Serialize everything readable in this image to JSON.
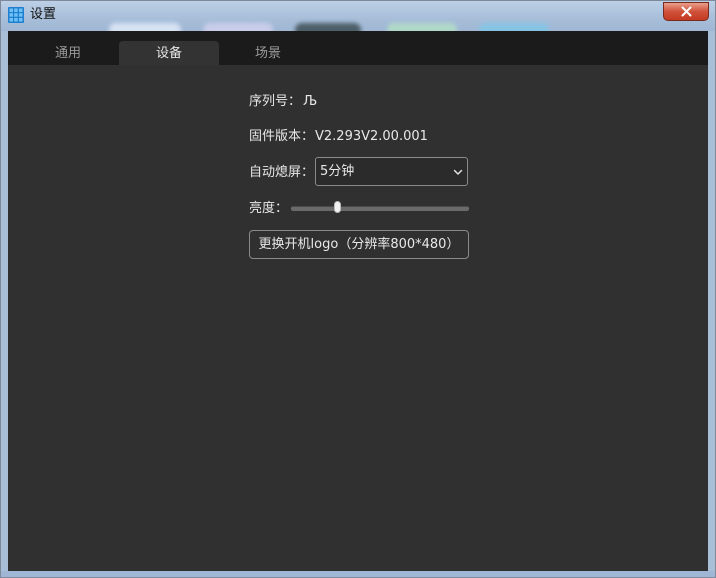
{
  "window": {
    "title": "设置"
  },
  "tabs": [
    {
      "label": "通用",
      "active": false
    },
    {
      "label": "设备",
      "active": true
    },
    {
      "label": "场景",
      "active": false
    }
  ],
  "device": {
    "serial_label": "序列号：",
    "serial_value": "Љ",
    "firmware_label": "固件版本：",
    "firmware_value": "V2.293V2.00.001",
    "auto_off_label": "自动熄屏：",
    "auto_off_value": "5分钟",
    "brightness_label": "亮度：",
    "brightness_fraction": 0.26,
    "change_logo_label": "更换开机logo（分辨率800*480）"
  },
  "colors": {
    "accent": "#2a8fd6",
    "close": "#c43a22",
    "content_bg": "#303030",
    "tabbar_bg": "#1b1b1b"
  },
  "icons": {
    "app": "app-grid-icon",
    "close": "close-icon",
    "dropdown": "chevron-down-icon"
  }
}
